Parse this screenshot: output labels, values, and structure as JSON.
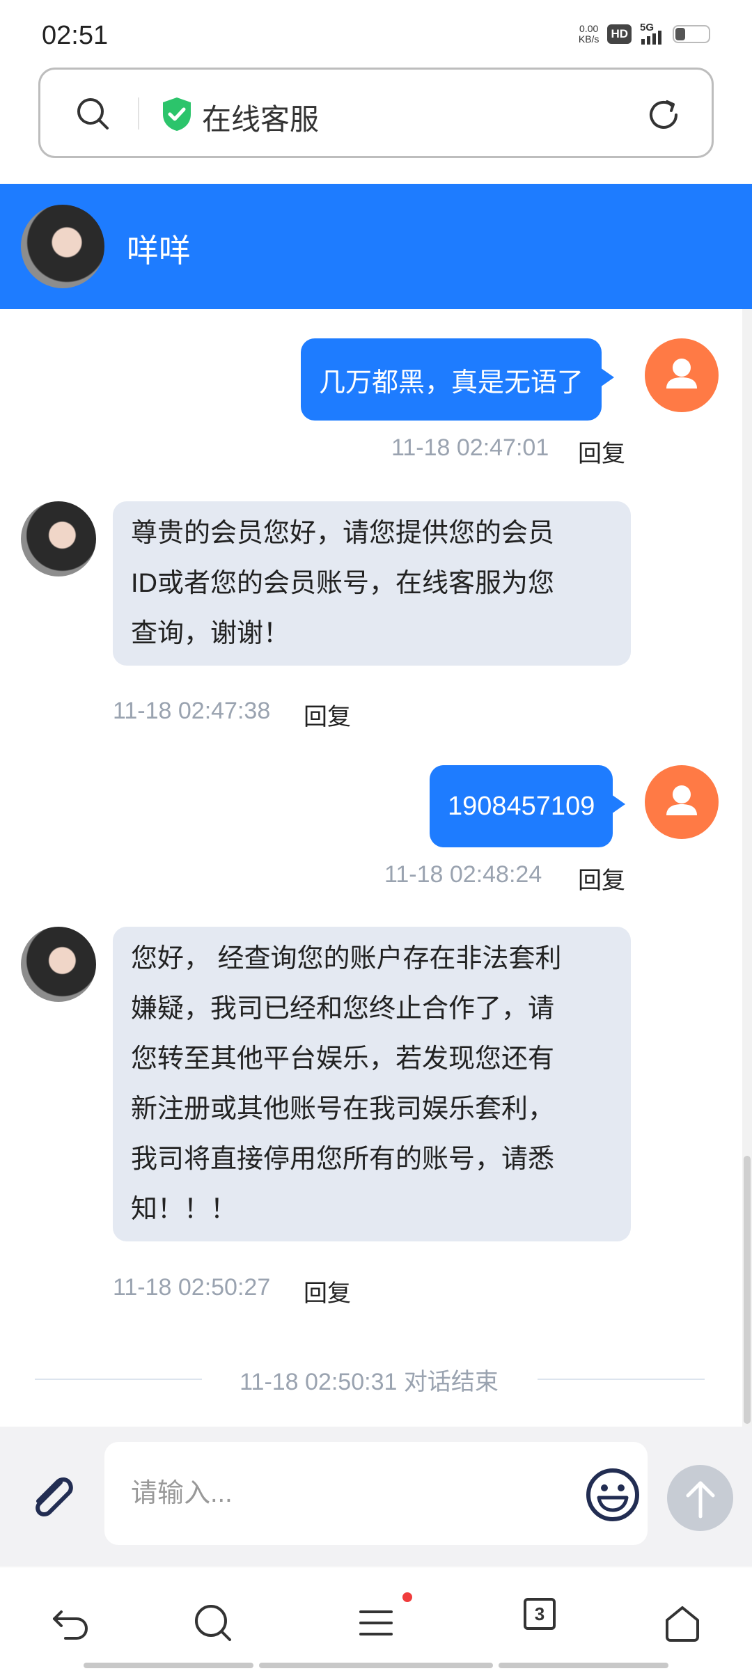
{
  "status_bar": {
    "time": "02:51",
    "net_speed_value": "0.00",
    "net_speed_unit": "KB/s",
    "hd_badge": "HD",
    "network": "5G"
  },
  "browser": {
    "title": "在线客服",
    "tab_count": "3"
  },
  "chat": {
    "agent_name": "咩咩",
    "messages": [
      {
        "sender": "user",
        "text": "几万都黑，真是无语了",
        "time": "11-18 02:47:01",
        "reply": "回复"
      },
      {
        "sender": "agent",
        "lines": [
          "尊贵的会员您好，请您提供您的会员",
          "ID或者您的会员账号，在线客服为您",
          "查询，谢谢！"
        ],
        "time": "11-18 02:47:38",
        "reply": "回复"
      },
      {
        "sender": "user",
        "text": "1908457109",
        "time": "11-18 02:48:24",
        "reply": "回复"
      },
      {
        "sender": "agent",
        "lines": [
          "您好， 经查询您的账户存在非法套利",
          "嫌疑，我司已经和您终止合作了，请",
          "您转至其他平台娱乐，若发现您还有",
          "新注册或其他账号在我司娱乐套利，",
          "我司将直接停用您所有的账号，请悉",
          "知！！！"
        ],
        "time": "11-18 02:50:27",
        "reply": "回复"
      }
    ],
    "end_notice": "11-18 02:50:31 对话结束"
  },
  "input": {
    "placeholder": "请输入..."
  },
  "icons": {
    "search": "search-icon",
    "shield": "shield-check-icon",
    "reload": "reload-icon",
    "attach": "paperclip-icon",
    "emoji": "emoji-icon",
    "send": "arrow-up-icon",
    "back": "back-icon",
    "menu": "menu-icon",
    "tabs": "tabs-icon",
    "home": "home-icon"
  },
  "colors": {
    "brand_blue": "#1e7cff",
    "user_avatar": "#ff7a45",
    "agent_bubble": "#e4e9f2",
    "timestamp": "#9aa3b0",
    "shield_green": "#2cc46b",
    "notify_red": "#f03c3c"
  }
}
